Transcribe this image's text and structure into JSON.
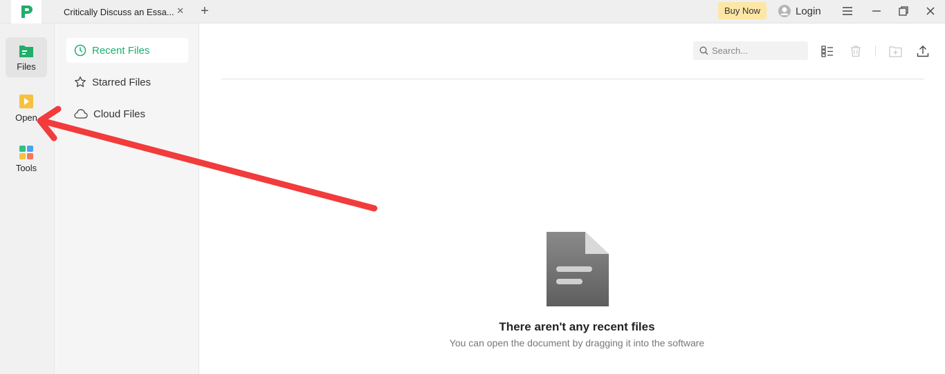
{
  "titlebar": {
    "tab_title": "Critically Discuss an Essa...",
    "tab_close": "✕",
    "new_tab": "+",
    "buy_now": "Buy Now",
    "login": "Login"
  },
  "rail": {
    "items": [
      {
        "label": "Files"
      },
      {
        "label": "Open"
      },
      {
        "label": "Tools"
      }
    ]
  },
  "nav": {
    "items": [
      {
        "label": "Recent Files"
      },
      {
        "label": "Starred Files"
      },
      {
        "label": "Cloud Files"
      }
    ]
  },
  "main": {
    "search_placeholder": "Search...",
    "empty_title": "There aren't any recent files",
    "empty_subtitle": "You can open the document by dragging it into the software"
  },
  "colors": {
    "accent": "#1fae6b",
    "buy_now_bg": "#fde7a6",
    "annotation_arrow": "#f23b3b"
  }
}
